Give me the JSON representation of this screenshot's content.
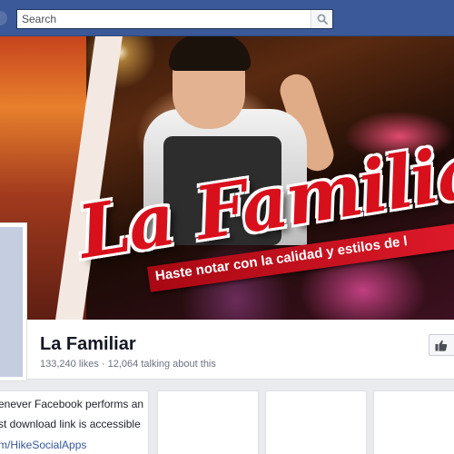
{
  "search": {
    "placeholder": "Search"
  },
  "page": {
    "name": "La Familiar",
    "likes": "133,240 likes",
    "separator": "·",
    "talking": "12,064 talking about this"
  },
  "cover": {
    "title": "La Familiar",
    "tagline": "Haste notar con la calidad y estilos de l"
  },
  "app_card": {
    "line1": "enever Facebook performs an",
    "line2": "st download link is accessible",
    "link": "m/HikeSocialApps"
  },
  "colors": {
    "facebook_blue": "#3b5998",
    "cover_red": "#d8101c",
    "link_blue": "#365899"
  }
}
